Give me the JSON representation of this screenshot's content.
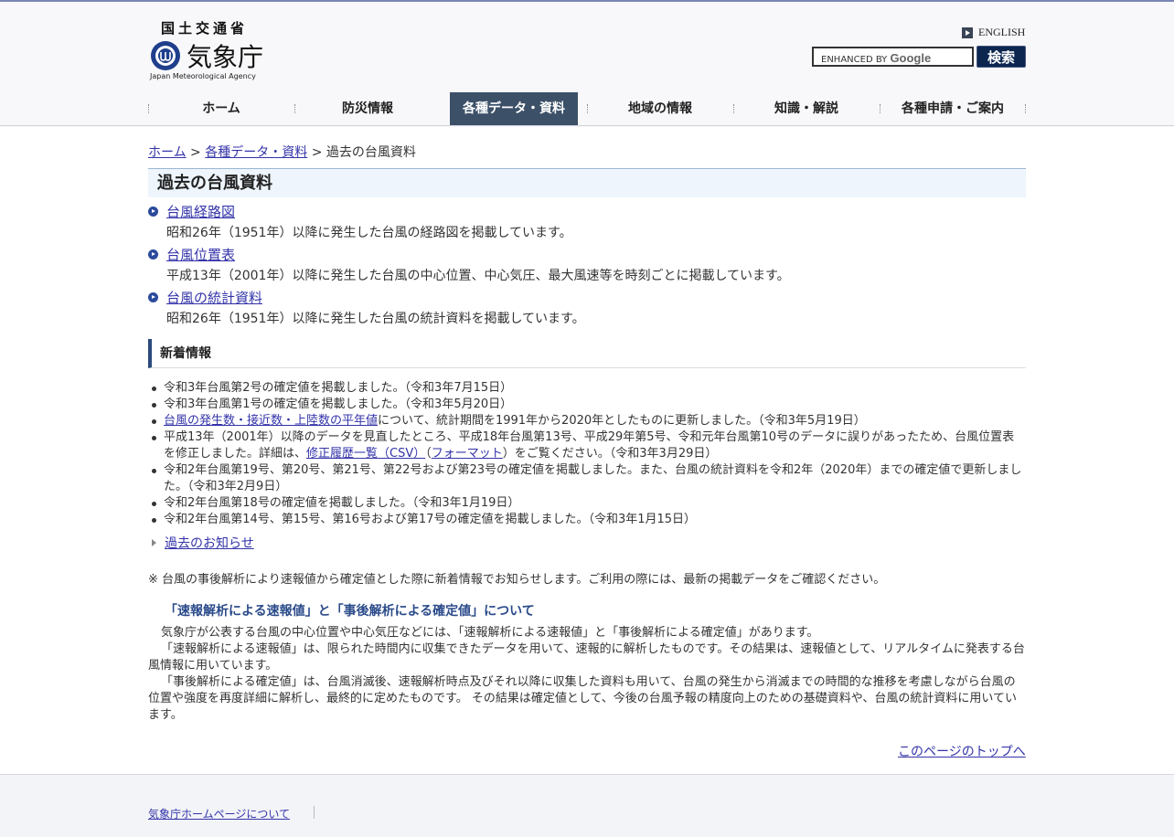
{
  "header": {
    "ministry": "国土交通省",
    "agency": "気象庁",
    "agency_en": "Japan Meteorological Agency",
    "english_link": "ENGLISH",
    "search_placeholder_prefix": "ENHANCED BY",
    "search_placeholder_brand": "Google",
    "search_button": "検索"
  },
  "nav": {
    "items": [
      {
        "label": "ホーム"
      },
      {
        "label": "防災情報"
      },
      {
        "label": "各種データ・資料"
      },
      {
        "label": "地域の情報"
      },
      {
        "label": "知識・解説"
      },
      {
        "label": "各種申請・ご案内"
      }
    ]
  },
  "breadcrumb": {
    "home": "ホーム",
    "sep": ">",
    "data": "各種データ・資料",
    "current": "過去の台風資料"
  },
  "page_title": "過去の台風資料",
  "links": [
    {
      "label": "台風経路図",
      "desc": "昭和26年（1951年）以降に発生した台風の経路図を掲載しています。"
    },
    {
      "label": "台風位置表",
      "desc": "平成13年（2001年）以降に発生した台風の中心位置、中心気圧、最大風速等を時刻ごとに掲載しています。"
    },
    {
      "label": "台風の統計資料",
      "desc": "昭和26年（1951年）以降に発生した台風の統計資料を掲載しています。"
    }
  ],
  "news": {
    "heading": "新着情報",
    "items": {
      "n1": "令和3年台風第2号の確定値を掲載しました。（令和3年7月15日）",
      "n2": "令和3年台風第1号の確定値を掲載しました。（令和3年5月20日）",
      "n3_link": "台風の発生数・接近数・上陸数の平年値",
      "n3_text": "について、統計期間を1991年から2020年としたものに更新しました。（令和3年5月19日）",
      "n4_a": "平成13年（2001年）以降のデータを見直したところ、平成18年台風第13号、平成29年第5号、令和元年台風第10号のデータに誤りがあったため、台風位置表を修正しました。詳細は、",
      "n4_link1": "修正履歴一覧（CSV）",
      "n4_b": "（",
      "n4_link2": "フォーマット",
      "n4_c": "）をご覧ください。（令和3年3月29日）",
      "n5": "令和2年台風第19号、第20号、第21号、第22号および第23号の確定値を掲載しました。また、台風の統計資料を令和2年（2020年）までの確定値で更新しました。（令和3年2月9日）",
      "n6": "令和2年台風第18号の確定値を掲載しました。（令和3年1月19日）",
      "n7": "令和2年台風第14号、第15号、第16号および第17号の確定値を掲載しました。（令和3年1月15日）"
    },
    "past_link": "過去のお知らせ"
  },
  "note": "※ 台風の事後解析により速報値から確定値とした際に新着情報でお知らせします。ご利用の際には、最新の掲載データをご確認ください。",
  "section": {
    "heading": "「速報解析による速報値」と「事後解析による確定値」について",
    "p1": "気象庁が公表する台風の中心位置や中心気圧などには、「速報解析による速報値」と「事後解析による確定値」があります。",
    "p2": "「速報解析による速報値」は、限られた時間内に収集できたデータを用いて、速報的に解析したものです。その結果は、速報値として、リアルタイムに発表する台風情報に用いています。",
    "p3": "「事後解析による確定値」は、台風消滅後、速報解析時点及びそれ以降に収集した資料も用いて、台風の発生から消滅までの時間的な推移を考慮しながら台風の位置や強度を再度詳細に解析し、最終的に定めたものです。 その結果は確定値として、今後の台風予報の精度向上のための基礎資料や、台風の統計資料に用いています。"
  },
  "to_top": "このページのトップへ",
  "footer": {
    "about": "気象庁ホームページについて"
  }
}
